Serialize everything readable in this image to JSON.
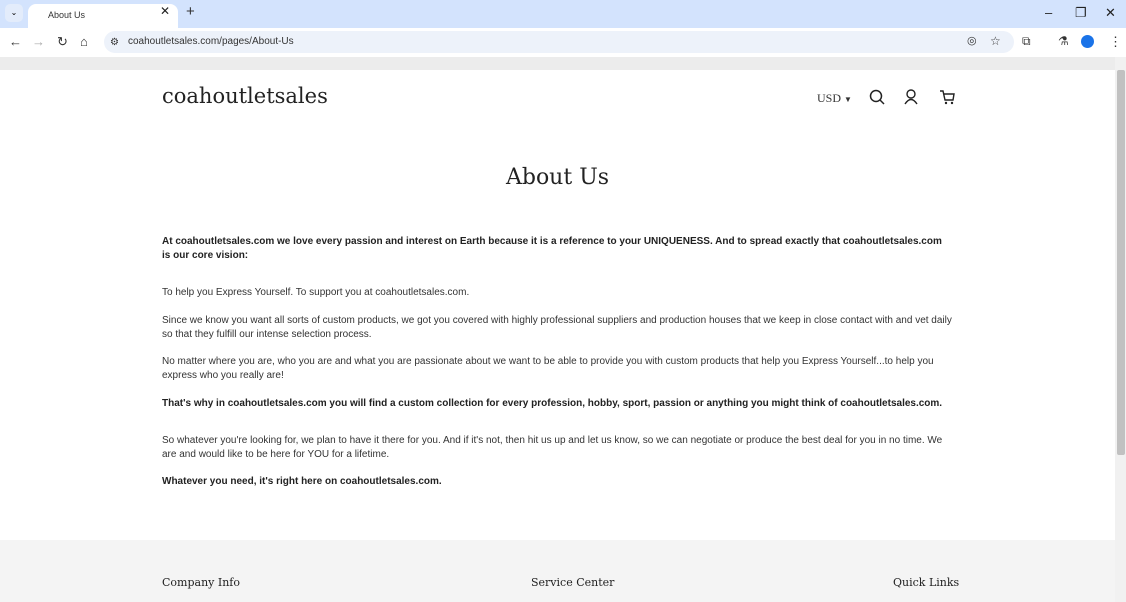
{
  "browser": {
    "tab_title": "About Us",
    "url": "coahoutletsales.com/pages/About-Us"
  },
  "header": {
    "logo": "coahoutletsales",
    "currency": "USD"
  },
  "page": {
    "title": "About Us",
    "paragraphs": [
      "At coahoutletsales.com we love every passion and interest on Earth because it is a reference to your UNIQUENESS. And to spread exactly that coahoutletsales.com is our core vision:",
      "To help you Express Yourself. To support you at coahoutletsales.com.",
      "Since we know you want all sorts of custom products, we got you covered with highly professional suppliers and production houses that we keep in close contact with and vet daily so that they fulfill our intense selection process.",
      "No matter where you are, who you are and what you are passionate about we want to be able to provide you with custom products that help you Express Yourself...to help you express who you really are!",
      "That's why in coahoutletsales.com you will find a custom collection for every profession, hobby, sport, passion or anything you might think of coahoutletsales.com.",
      "So whatever you're looking for, we plan to have it there for you. And if it's not, then hit us up and let us know, so we can negotiate or produce the best deal for you in no time. We are and would like to be here for YOU for a lifetime.",
      "Whatever you need, it's right here on coahoutletsales.com."
    ]
  },
  "footer": {
    "headings": [
      "Company Info",
      "Service Center",
      "Quick Links"
    ]
  }
}
